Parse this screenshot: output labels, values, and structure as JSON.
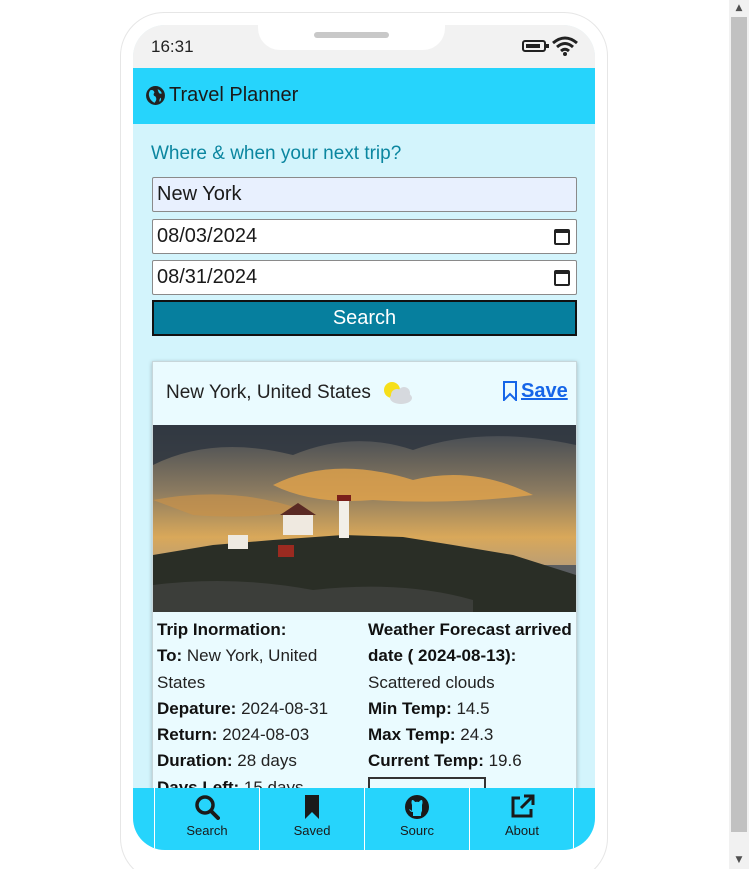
{
  "status_bar": {
    "time": "16:31"
  },
  "app_bar": {
    "title": "Travel Planner",
    "icon": "globe-icon"
  },
  "form": {
    "heading": "Where & when your next trip?",
    "destination_value": "New York",
    "depart_date": "08/03/2024",
    "return_date": "08/31/2024",
    "search_label": "Search"
  },
  "trip_card": {
    "location": "New York, United States",
    "weather_icon": "partly-cloudy-icon",
    "save_label": "Save",
    "info_title": "Trip Inormation:",
    "to_label": "To:",
    "to_value": "New York, United States",
    "depart_label": "Depature:",
    "depart_value": "2024-08-31",
    "return_label": "Return:",
    "return_value": "2024-08-03",
    "duration_label": "Duration:",
    "duration_value": "28 days",
    "days_left_label": "Days Left:",
    "days_left_value": "15 days",
    "forecast_title": "Weather Forecast arrived date ( 2024-08-13):",
    "forecast_desc": "Scattered clouds",
    "min_label": "Min Temp:",
    "min_value": "14.5",
    "max_label": "Max Temp:",
    "max_value": "24.3",
    "current_label": "Current Temp:",
    "current_value": "19.6"
  },
  "bottom_nav": [
    {
      "label": "Search",
      "icon": "search-icon"
    },
    {
      "label": "Saved",
      "icon": "bookmark-icon"
    },
    {
      "label": "Sourc",
      "icon": "github-icon"
    },
    {
      "label": "About",
      "icon": "external-link-icon"
    }
  ],
  "colors": {
    "app_bar": "#26d4fc",
    "screen_bg": "#d3f4fc",
    "heading": "#0b86a0",
    "search_button": "#067f9e",
    "save_link": "#1565e8"
  }
}
